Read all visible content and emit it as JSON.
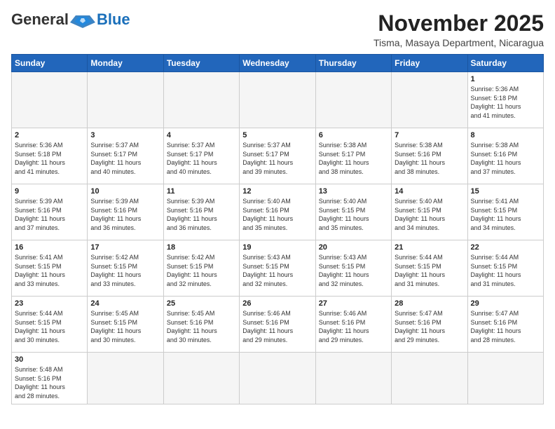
{
  "header": {
    "logo_general": "General",
    "logo_blue": "Blue",
    "month_title": "November 2025",
    "location": "Tisma, Masaya Department, Nicaragua"
  },
  "days_of_week": [
    "Sunday",
    "Monday",
    "Tuesday",
    "Wednesday",
    "Thursday",
    "Friday",
    "Saturday"
  ],
  "weeks": [
    [
      {
        "day": "",
        "info": ""
      },
      {
        "day": "",
        "info": ""
      },
      {
        "day": "",
        "info": ""
      },
      {
        "day": "",
        "info": ""
      },
      {
        "day": "",
        "info": ""
      },
      {
        "day": "",
        "info": ""
      },
      {
        "day": "1",
        "info": "Sunrise: 5:36 AM\nSunset: 5:18 PM\nDaylight: 11 hours\nand 41 minutes."
      }
    ],
    [
      {
        "day": "2",
        "info": "Sunrise: 5:36 AM\nSunset: 5:18 PM\nDaylight: 11 hours\nand 41 minutes."
      },
      {
        "day": "3",
        "info": "Sunrise: 5:37 AM\nSunset: 5:17 PM\nDaylight: 11 hours\nand 40 minutes."
      },
      {
        "day": "4",
        "info": "Sunrise: 5:37 AM\nSunset: 5:17 PM\nDaylight: 11 hours\nand 40 minutes."
      },
      {
        "day": "5",
        "info": "Sunrise: 5:37 AM\nSunset: 5:17 PM\nDaylight: 11 hours\nand 39 minutes."
      },
      {
        "day": "6",
        "info": "Sunrise: 5:38 AM\nSunset: 5:17 PM\nDaylight: 11 hours\nand 38 minutes."
      },
      {
        "day": "7",
        "info": "Sunrise: 5:38 AM\nSunset: 5:16 PM\nDaylight: 11 hours\nand 38 minutes."
      },
      {
        "day": "8",
        "info": "Sunrise: 5:38 AM\nSunset: 5:16 PM\nDaylight: 11 hours\nand 37 minutes."
      }
    ],
    [
      {
        "day": "9",
        "info": "Sunrise: 5:39 AM\nSunset: 5:16 PM\nDaylight: 11 hours\nand 37 minutes."
      },
      {
        "day": "10",
        "info": "Sunrise: 5:39 AM\nSunset: 5:16 PM\nDaylight: 11 hours\nand 36 minutes."
      },
      {
        "day": "11",
        "info": "Sunrise: 5:39 AM\nSunset: 5:16 PM\nDaylight: 11 hours\nand 36 minutes."
      },
      {
        "day": "12",
        "info": "Sunrise: 5:40 AM\nSunset: 5:16 PM\nDaylight: 11 hours\nand 35 minutes."
      },
      {
        "day": "13",
        "info": "Sunrise: 5:40 AM\nSunset: 5:15 PM\nDaylight: 11 hours\nand 35 minutes."
      },
      {
        "day": "14",
        "info": "Sunrise: 5:40 AM\nSunset: 5:15 PM\nDaylight: 11 hours\nand 34 minutes."
      },
      {
        "day": "15",
        "info": "Sunrise: 5:41 AM\nSunset: 5:15 PM\nDaylight: 11 hours\nand 34 minutes."
      }
    ],
    [
      {
        "day": "16",
        "info": "Sunrise: 5:41 AM\nSunset: 5:15 PM\nDaylight: 11 hours\nand 33 minutes."
      },
      {
        "day": "17",
        "info": "Sunrise: 5:42 AM\nSunset: 5:15 PM\nDaylight: 11 hours\nand 33 minutes."
      },
      {
        "day": "18",
        "info": "Sunrise: 5:42 AM\nSunset: 5:15 PM\nDaylight: 11 hours\nand 32 minutes."
      },
      {
        "day": "19",
        "info": "Sunrise: 5:43 AM\nSunset: 5:15 PM\nDaylight: 11 hours\nand 32 minutes."
      },
      {
        "day": "20",
        "info": "Sunrise: 5:43 AM\nSunset: 5:15 PM\nDaylight: 11 hours\nand 32 minutes."
      },
      {
        "day": "21",
        "info": "Sunrise: 5:44 AM\nSunset: 5:15 PM\nDaylight: 11 hours\nand 31 minutes."
      },
      {
        "day": "22",
        "info": "Sunrise: 5:44 AM\nSunset: 5:15 PM\nDaylight: 11 hours\nand 31 minutes."
      }
    ],
    [
      {
        "day": "23",
        "info": "Sunrise: 5:44 AM\nSunset: 5:15 PM\nDaylight: 11 hours\nand 30 minutes."
      },
      {
        "day": "24",
        "info": "Sunrise: 5:45 AM\nSunset: 5:15 PM\nDaylight: 11 hours\nand 30 minutes."
      },
      {
        "day": "25",
        "info": "Sunrise: 5:45 AM\nSunset: 5:16 PM\nDaylight: 11 hours\nand 30 minutes."
      },
      {
        "day": "26",
        "info": "Sunrise: 5:46 AM\nSunset: 5:16 PM\nDaylight: 11 hours\nand 29 minutes."
      },
      {
        "day": "27",
        "info": "Sunrise: 5:46 AM\nSunset: 5:16 PM\nDaylight: 11 hours\nand 29 minutes."
      },
      {
        "day": "28",
        "info": "Sunrise: 5:47 AM\nSunset: 5:16 PM\nDaylight: 11 hours\nand 29 minutes."
      },
      {
        "day": "29",
        "info": "Sunrise: 5:47 AM\nSunset: 5:16 PM\nDaylight: 11 hours\nand 28 minutes."
      }
    ],
    [
      {
        "day": "30",
        "info": "Sunrise: 5:48 AM\nSunset: 5:16 PM\nDaylight: 11 hours\nand 28 minutes."
      },
      {
        "day": "",
        "info": ""
      },
      {
        "day": "",
        "info": ""
      },
      {
        "day": "",
        "info": ""
      },
      {
        "day": "",
        "info": ""
      },
      {
        "day": "",
        "info": ""
      },
      {
        "day": "",
        "info": ""
      }
    ]
  ]
}
